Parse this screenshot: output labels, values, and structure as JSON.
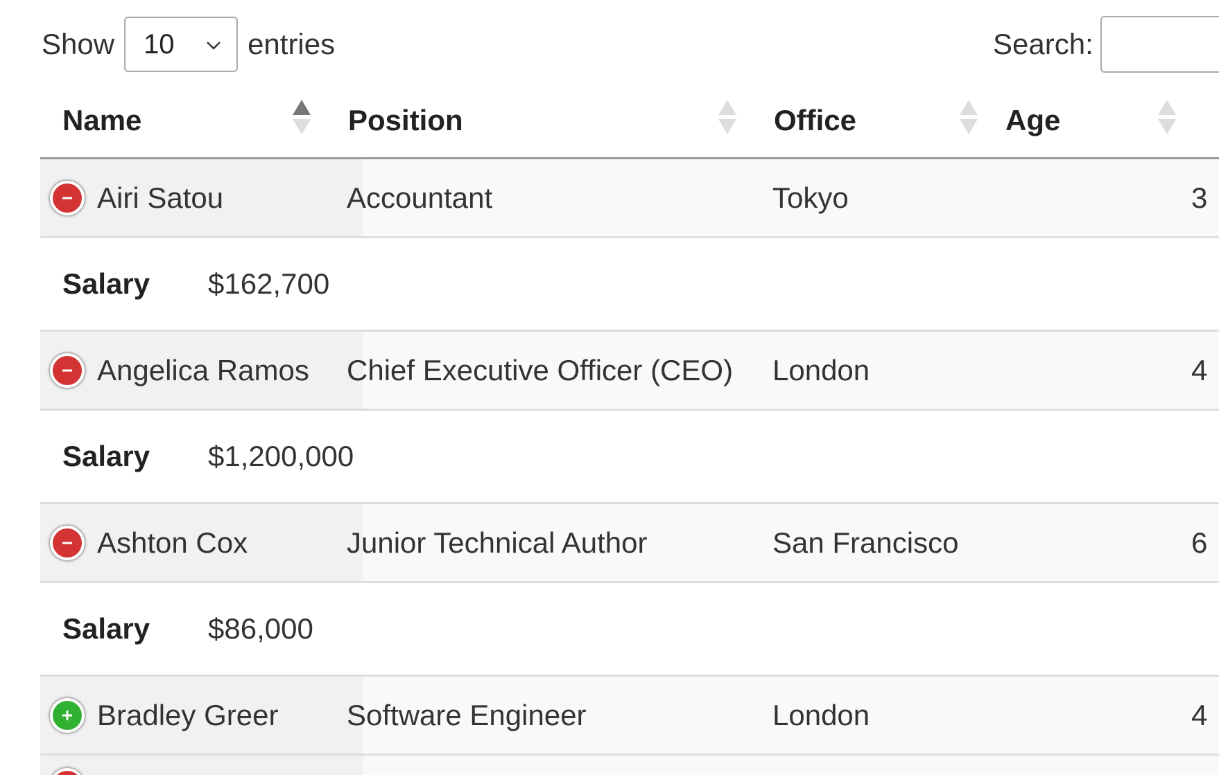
{
  "length_control": {
    "prefix": "Show",
    "selected": "10",
    "suffix": "entries"
  },
  "search": {
    "label": "Search:",
    "value": ""
  },
  "table": {
    "columns": [
      {
        "label": "Name",
        "sort": "asc"
      },
      {
        "label": "Position",
        "sort": "none"
      },
      {
        "label": "Office",
        "sort": "none"
      },
      {
        "label": "Age",
        "sort": "none"
      }
    ],
    "rows": [
      {
        "name": "Airi Satou",
        "position": "Accountant",
        "office": "Tokyo",
        "age": "3",
        "expanded": true,
        "detail": {
          "label": "Salary",
          "value": "$162,700"
        }
      },
      {
        "name": "Angelica Ramos",
        "position": "Chief Executive Officer (CEO)",
        "office": "London",
        "age": "4",
        "expanded": true,
        "detail": {
          "label": "Salary",
          "value": "$1,200,000"
        }
      },
      {
        "name": "Ashton Cox",
        "position": "Junior Technical Author",
        "office": "San Francisco",
        "age": "6",
        "expanded": true,
        "detail": {
          "label": "Salary",
          "value": "$86,000"
        }
      },
      {
        "name": "Bradley Greer",
        "position": "Software Engineer",
        "office": "London",
        "age": "4",
        "expanded": false
      }
    ]
  },
  "colors": {
    "collapse_button": "#d33333",
    "expand_button": "#31b131",
    "header_border": "#999999",
    "row_border": "#dddddd"
  },
  "icons": {
    "collapse": "minus-circle-icon",
    "expand": "plus-circle-icon",
    "sort_asc": "sort-ascending-icon",
    "sort_both": "sort-both-icon",
    "select_caret": "chevron-down-icon"
  }
}
